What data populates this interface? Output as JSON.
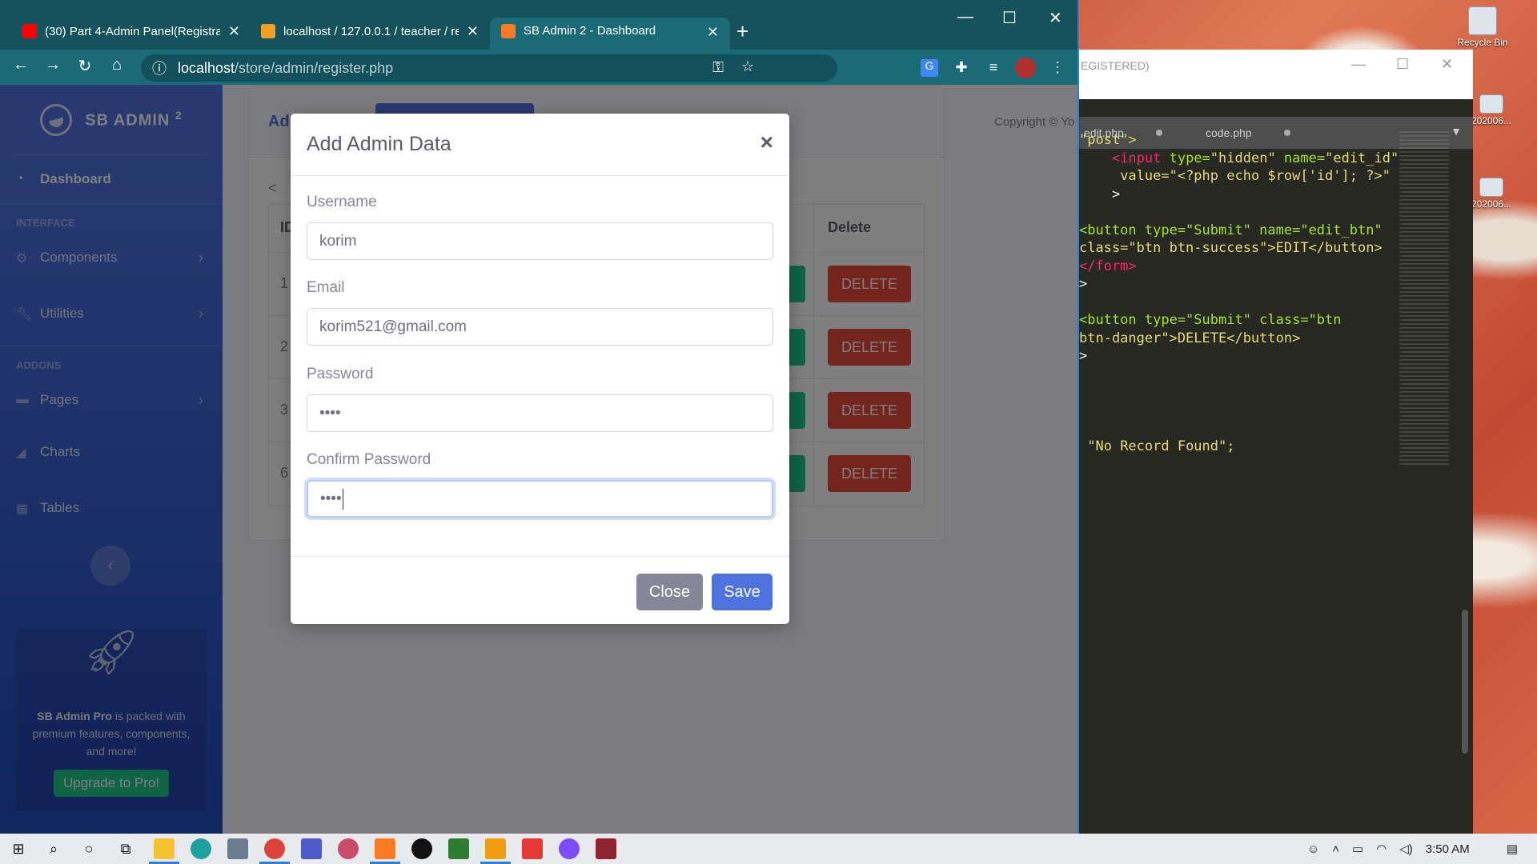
{
  "browser": {
    "tabs": [
      {
        "title": "(30) Part 4-Admin Panel(Registra",
        "icon": "youtube-icon",
        "color": "#ff0000"
      },
      {
        "title": "localhost / 127.0.0.1 / teacher / re",
        "icon": "phpmyadmin-icon",
        "color": "#f0a020"
      },
      {
        "title": "SB Admin 2 - Dashboard",
        "icon": "xampp-icon",
        "color": "#fb7a24"
      }
    ],
    "url_host": "localhost",
    "url_path": "/store/admin/register.php"
  },
  "sidebar": {
    "brand": "SB ADMIN",
    "brand_sup": "2",
    "dashboard": "Dashboard",
    "heading_interface": "INTERFACE",
    "components": "Components",
    "utilities": "Utilities",
    "heading_addons": "ADDONS",
    "pages": "Pages",
    "charts": "Charts",
    "tables": "Tables",
    "promo_bold": "SB Admin Pro",
    "promo_text": " is packed with premium features, components, and more!",
    "promo_button": "Upgrade to Pro!"
  },
  "background_page": {
    "card_title": "Ad",
    "copyright": "Copyright © Yo",
    "prev": "<",
    "col_id": "ID",
    "col_delete": "Delete",
    "rows": [
      {
        "id": "1",
        "delete": "DELETE"
      },
      {
        "id": "2",
        "delete": "DELETE"
      },
      {
        "id": "3",
        "delete": "DELETE"
      },
      {
        "id": "6",
        "delete": "DELETE"
      }
    ]
  },
  "modal": {
    "title": "Add Admin Data",
    "close_x": "×",
    "username_label": "Username",
    "username_value": "korim",
    "email_label": "Email",
    "email_value": "korim521@gmail.com",
    "password_label": "Password",
    "password_value": "••••",
    "confirm_label": "Confirm Password",
    "confirm_value": "••••",
    "close_button": "Close",
    "save_button": "Save"
  },
  "editor": {
    "title": "EGISTERED)",
    "tab1": "edit.php",
    "tab2": "code.php",
    "code": {
      "l1": "\"post\">",
      "l2a": "<input",
      "l2b": " type=",
      "l2c": "\"hidden\"",
      "l2d": " name=",
      "l2e": "\"edit_id\"",
      "l3": "value=\"<?php echo $row['id']; ?>\"",
      "l4": ">",
      "l5": "<button type=\"Submit\" name=\"edit_btn\"",
      "l6": "class=\"btn btn-success\">EDIT</button>",
      "l7": "</form>",
      "l8": ">",
      "l9": "<button type=\"Submit\" class=\"btn",
      "l10": "btn-danger\">DELETE</button>",
      "l11": ">",
      "l12": "\"No Record Found\";"
    }
  },
  "desktop": {
    "recycle_bin": "Recycle Bin",
    "file1": "202006...",
    "file2": "202006..."
  },
  "taskbar": {
    "time": "3:50 AM"
  }
}
